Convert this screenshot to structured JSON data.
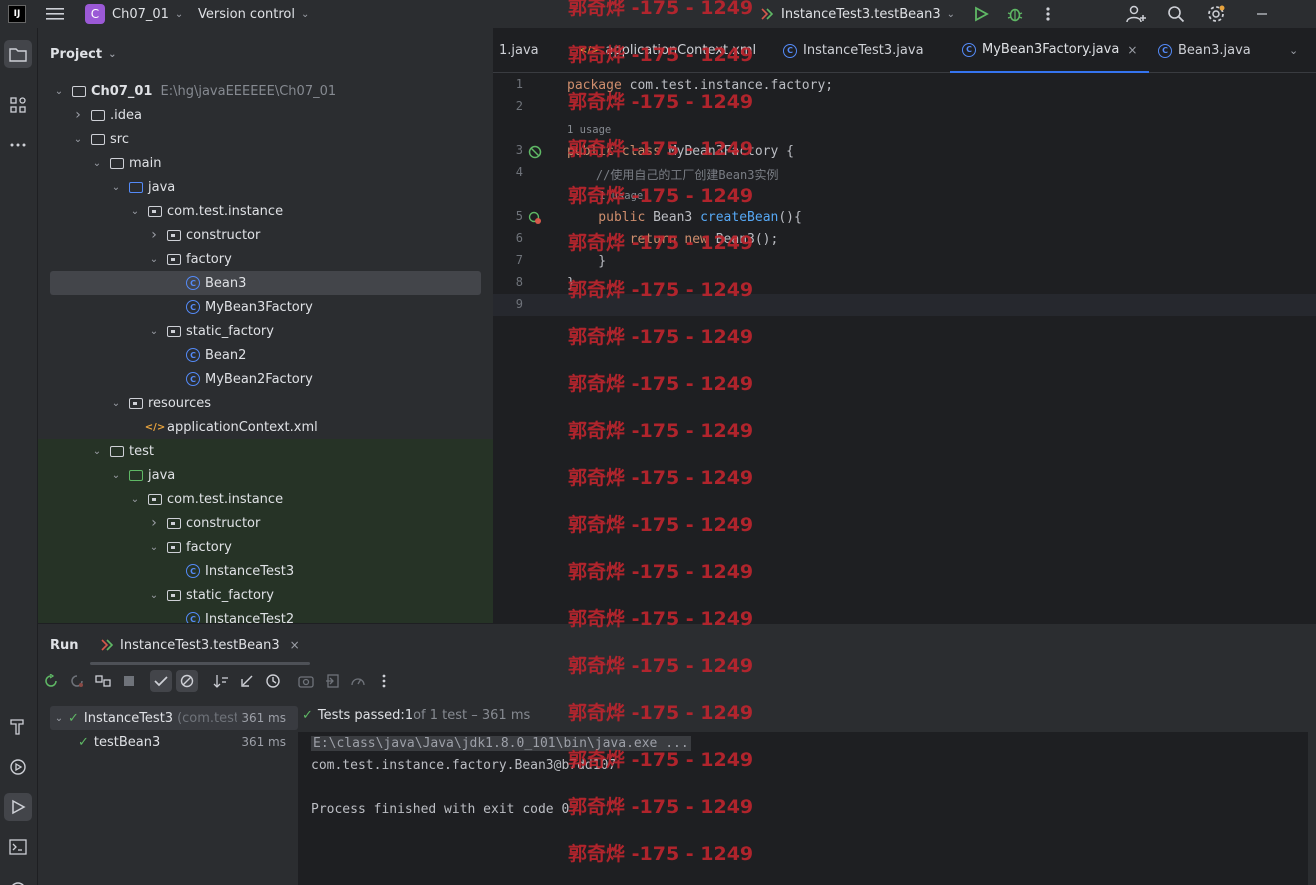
{
  "titlebar": {
    "logo_text": "IJ",
    "project_badge": "C",
    "project_name": "Ch07_01",
    "vcs_label": "Version control",
    "run_config": "InstanceTest3.testBean3"
  },
  "project_panel": {
    "title": "Project",
    "root_name": "Ch07_01",
    "root_path": "E:\\hg\\javaEEEEEE\\Ch07_01",
    "tree": [
      {
        "label": "Ch07_01",
        "sub": "E:\\hg\\javaEEEEEE\\Ch07_01",
        "depth": 0,
        "icon": "folder-icon",
        "expanded": true,
        "bold": true
      },
      {
        "label": ".idea",
        "depth": 1,
        "icon": "folder-icon",
        "expanded": false
      },
      {
        "label": "src",
        "depth": 1,
        "icon": "folder-icon",
        "expanded": true
      },
      {
        "label": "main",
        "depth": 2,
        "icon": "folder-icon",
        "expanded": true
      },
      {
        "label": "java",
        "depth": 3,
        "icon": "source-folder-icon",
        "expanded": true
      },
      {
        "label": "com.test.instance",
        "depth": 4,
        "icon": "package-icon",
        "expanded": true
      },
      {
        "label": "constructor",
        "depth": 5,
        "icon": "package-icon",
        "expanded": false
      },
      {
        "label": "factory",
        "depth": 5,
        "icon": "package-icon",
        "expanded": true
      },
      {
        "label": "Bean3",
        "depth": 6,
        "icon": "class-icon",
        "selected": true
      },
      {
        "label": "MyBean3Factory",
        "depth": 6,
        "icon": "class-icon"
      },
      {
        "label": "static_factory",
        "depth": 5,
        "icon": "package-icon",
        "expanded": true
      },
      {
        "label": "Bean2",
        "depth": 6,
        "icon": "class-icon"
      },
      {
        "label": "MyBean2Factory",
        "depth": 6,
        "icon": "class-icon"
      },
      {
        "label": "resources",
        "depth": 3,
        "icon": "resources-folder-icon",
        "expanded": true
      },
      {
        "label": "applicationContext.xml",
        "depth": 4,
        "icon": "xml-file-icon"
      },
      {
        "label": "test",
        "depth": 2,
        "icon": "folder-icon",
        "expanded": true,
        "green": true
      },
      {
        "label": "java",
        "depth": 3,
        "icon": "test-folder-icon",
        "expanded": true,
        "green": true
      },
      {
        "label": "com.test.instance",
        "depth": 4,
        "icon": "package-icon",
        "expanded": true,
        "green": true
      },
      {
        "label": "constructor",
        "depth": 5,
        "icon": "package-icon",
        "expanded": false,
        "green": true
      },
      {
        "label": "factory",
        "depth": 5,
        "icon": "package-icon",
        "expanded": true,
        "green": true
      },
      {
        "label": "InstanceTest3",
        "depth": 6,
        "icon": "class-icon",
        "green": true
      },
      {
        "label": "static_factory",
        "depth": 5,
        "icon": "package-icon",
        "expanded": true,
        "green": true
      },
      {
        "label": "InstanceTest2",
        "depth": 6,
        "icon": "class-icon",
        "green": true
      }
    ]
  },
  "editor": {
    "tabs": [
      {
        "label": "1.java",
        "icon": "none"
      },
      {
        "label": "applicationContext.xml",
        "icon": "xml-file-icon"
      },
      {
        "label": "InstanceTest3.java",
        "icon": "class-icon"
      },
      {
        "label": "MyBean3Factory.java",
        "icon": "class-icon",
        "active": true
      },
      {
        "label": "Bean3.java",
        "icon": "class-icon"
      }
    ],
    "close_glyph": "×",
    "line_numbers": [
      "1",
      "2",
      "3",
      "4",
      "5",
      "6",
      "7",
      "8",
      "9"
    ],
    "usage_hint_1": "1 usage",
    "usage_hint_2": "1 usage",
    "code": {
      "l1_kw": "package",
      "l1_rest": " com.test.instance.factory;",
      "l3_kw": "public class",
      "l3_rest": " MyBean3Factory {",
      "l4_comment": "    //使用自己的工厂创建Bean3实例",
      "l5_kw": "    public",
      "l5_mid": " Bean3 ",
      "l5_fn": "createBean",
      "l5_rest": "(){",
      "l6_kw": "        return new",
      "l6_rest": " Bean3();",
      "l7": "    }",
      "l8": "}"
    }
  },
  "watermark": "郭奇烨 -175 - 1249",
  "run_panel": {
    "title": "Run",
    "tab_label": "InstanceTest3.testBean3",
    "tests": [
      {
        "name": "InstanceTest3",
        "sub": "(com.test",
        "time": "361 ms"
      },
      {
        "name": "testBean3",
        "time": "361 ms"
      }
    ],
    "status_prefix": "Tests passed: ",
    "status_count": "1",
    "status_rest": " of 1 test – 361 ms",
    "console": [
      "E:\\class\\java\\Java\\jdk1.8.0_101\\bin\\java.exe ...",
      "com.test.instance.factory.Bean3@b7dd107",
      "",
      "Process finished with exit code 0"
    ]
  },
  "colors": {
    "accent": "#3574f0",
    "success": "#5fb865",
    "watermark": "#c0252e"
  }
}
